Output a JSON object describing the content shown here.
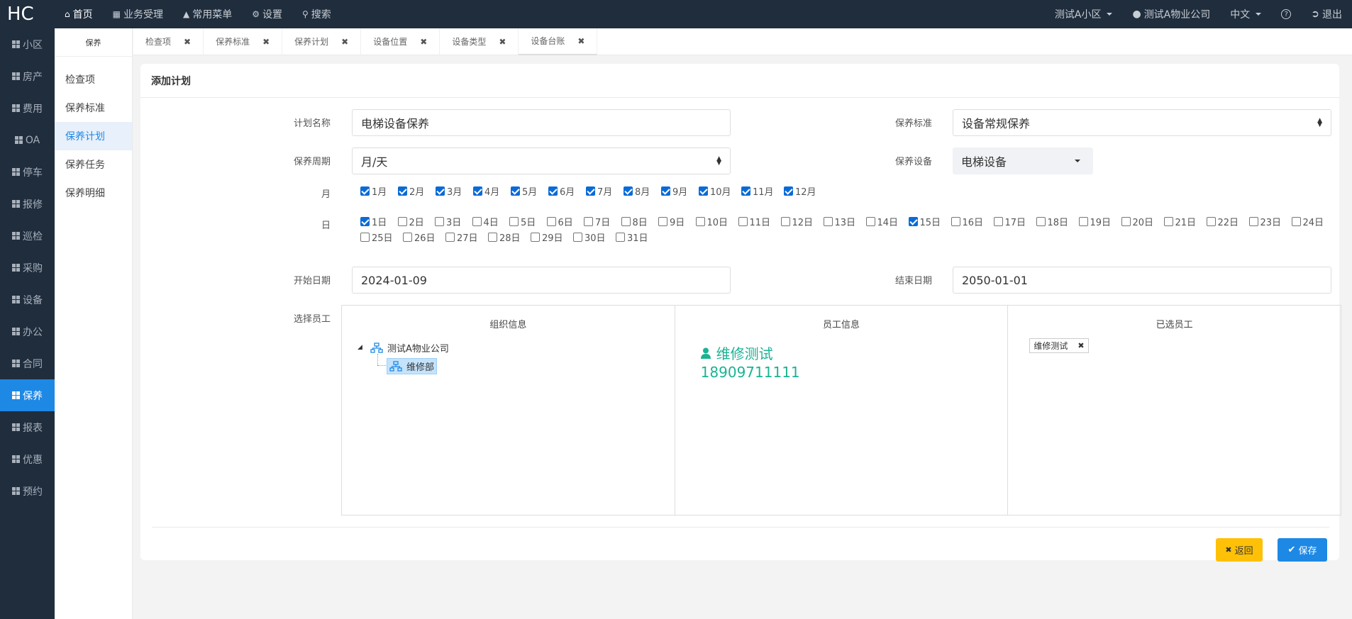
{
  "topbar": {
    "logo": "HC",
    "nav": [
      {
        "label": "首页",
        "icon": "home-icon"
      },
      {
        "label": "业务受理",
        "icon": "calculator-icon"
      },
      {
        "label": "常用菜单",
        "icon": "sitemap-icon"
      },
      {
        "label": "设置",
        "icon": "gear-icon"
      },
      {
        "label": "搜索",
        "icon": "search-icon"
      }
    ],
    "community": "测试A小区",
    "company": "测试A物业公司",
    "language": "中文",
    "help": "?",
    "logout": "退出"
  },
  "sidebar": {
    "items": [
      "小区",
      "房产",
      "费用",
      "OA",
      "停车",
      "报修",
      "巡检",
      "采购",
      "设备",
      "办公",
      "合同",
      "保养",
      "报表",
      "优惠",
      "预约"
    ],
    "active_index": 11
  },
  "subside": {
    "title": "保养",
    "items": [
      "检查项",
      "保养标准",
      "保养计划",
      "保养任务",
      "保养明细"
    ],
    "active_index": 2
  },
  "tabs": [
    "检查项",
    "保养标准",
    "保养计划",
    "设备位置",
    "设备类型",
    "设备台账"
  ],
  "form": {
    "title": "添加计划",
    "plan_name_label": "计划名称",
    "plan_name": "电梯设备保养",
    "standard_label": "保养标准",
    "standard": "设备常规保养",
    "period_label": "保养周期",
    "period": "月/天",
    "device_label": "保养设备",
    "device": "电梯设备",
    "month_label": "月",
    "months": [
      "1月",
      "2月",
      "3月",
      "4月",
      "5月",
      "6月",
      "7月",
      "8月",
      "9月",
      "10月",
      "11月",
      "12月"
    ],
    "months_checked": [
      1,
      2,
      3,
      4,
      5,
      6,
      7,
      8,
      9,
      10,
      11,
      12
    ],
    "day_label": "日",
    "days": [
      "1日",
      "2日",
      "3日",
      "4日",
      "5日",
      "6日",
      "7日",
      "8日",
      "9日",
      "10日",
      "11日",
      "12日",
      "13日",
      "14日",
      "15日",
      "16日",
      "17日",
      "18日",
      "19日",
      "20日",
      "21日",
      "22日",
      "23日",
      "24日",
      "25日",
      "26日",
      "27日",
      "28日",
      "29日",
      "30日",
      "31日"
    ],
    "days_checked": [
      1,
      15
    ],
    "start_label": "开始日期",
    "start_date": "2024-01-09",
    "end_label": "结束日期",
    "end_date": "2050-01-01",
    "staff_label": "选择员工"
  },
  "panels": {
    "org_title": "组织信息",
    "org_root": "测试A物业公司",
    "org_child": "维修部",
    "staff_title": "员工信息",
    "staff_name": "维修测试",
    "staff_phone": "18909711111",
    "selected_title": "已选员工",
    "selected_tag": "维修测试"
  },
  "buttons": {
    "back": "返回",
    "save": "保存"
  },
  "colors": {
    "nav_bg": "#1f2d3d",
    "accent": "#1e88e5",
    "green": "#1ab394",
    "warning": "#ffc107"
  }
}
